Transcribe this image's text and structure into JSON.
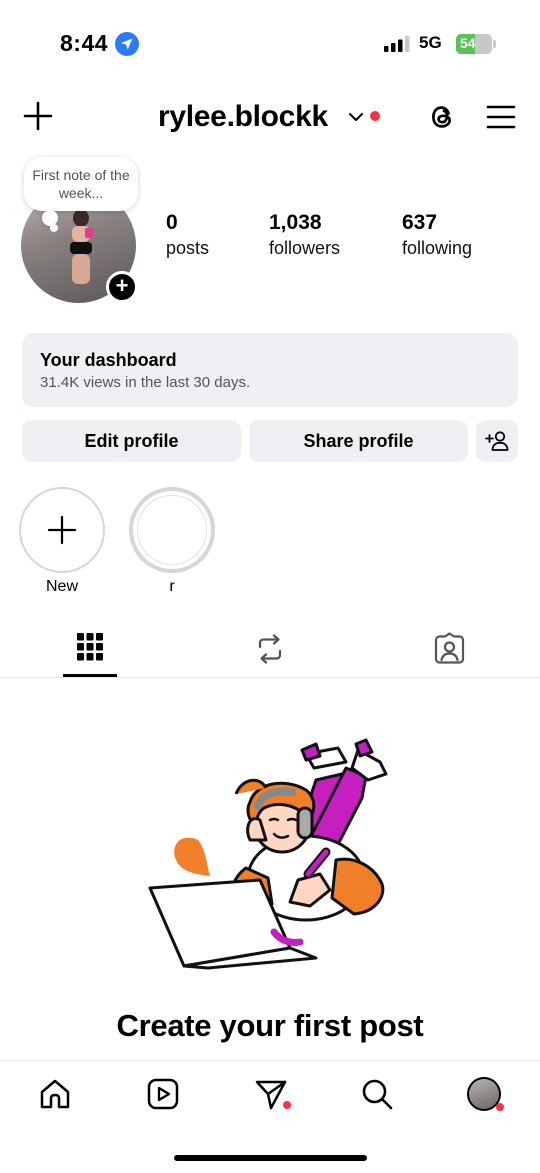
{
  "status_bar": {
    "time": "8:44",
    "network": "5G",
    "battery": 54,
    "battery_label": "54",
    "icons": [
      "location-arrow-icon",
      "signal-bars-icon",
      "battery-icon"
    ]
  },
  "header": {
    "username": "rylee.blockk",
    "icons": [
      "plus-icon",
      "chevron-down-icon",
      "threads-icon",
      "menu-icon"
    ],
    "notification_color": "#ff3040"
  },
  "profile": {
    "note": "First note of the week...",
    "stats": [
      {
        "value": "0",
        "label": "posts"
      },
      {
        "value": "1,038",
        "label": "followers"
      },
      {
        "value": "637",
        "label": "following"
      }
    ]
  },
  "dashboard": {
    "title": "Your dashboard",
    "subtitle": "31.4K views in the last 30 days."
  },
  "actions": {
    "edit_label": "Edit profile",
    "share_label": "Share profile"
  },
  "highlights": [
    {
      "label": "New"
    },
    {
      "label": "r"
    }
  ],
  "tabs": [
    "grid-icon",
    "reposts-icon",
    "tagged-icon"
  ],
  "empty_state": {
    "title": "Create your first post"
  },
  "bottom_nav": {
    "items": [
      "home-icon",
      "reels-icon",
      "messages-icon",
      "search-icon",
      "profile-avatar"
    ]
  },
  "colors": {
    "accent_red": "#ff3040",
    "surface": "#efeff4",
    "illustration_orange": "#f07f2a",
    "illustration_magenta": "#c61fbf"
  }
}
